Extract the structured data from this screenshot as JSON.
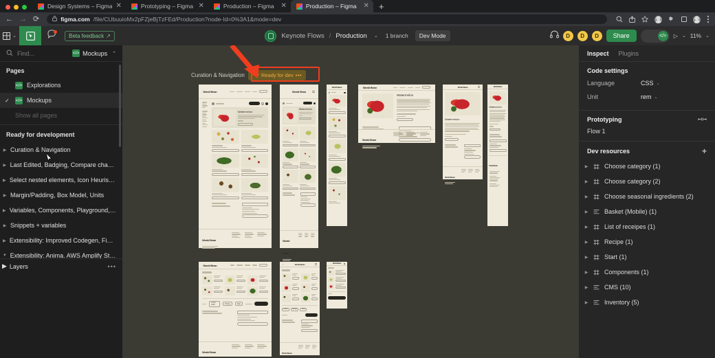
{
  "browser": {
    "tabs": [
      {
        "title": "Design Systems – Figma",
        "active": false
      },
      {
        "title": "Prototyping – Figma",
        "active": false
      },
      {
        "title": "Production – Figma",
        "active": false
      },
      {
        "title": "Production – Figma",
        "active": true
      }
    ],
    "new_tab_label": "+",
    "close_label": "✕",
    "back_label": "←",
    "forward_label": "→",
    "reload_label": "⟳",
    "url_host": "figma.com",
    "url_path": "/file/CUbuuioMx2pFZjeBjTzFEd/Production?node-Id=0%3A1&mode=dev",
    "lock_label": "🔒",
    "toolbar_icons": [
      "search-icon",
      "share-icon",
      "bookmark-star-icon",
      "extension-puzzle-icon",
      "sidepanel-icon",
      "profile-icon",
      "menu-kebab-icon"
    ],
    "profile_initial": ""
  },
  "figma_toolbar": {
    "menu_label": "",
    "caret": "⌄",
    "move_tool": "cursor-tool",
    "comment_tool": "comment-tool",
    "beta_feedback": "Beta feedback",
    "beta_external_icon": "↗",
    "team_name": "Keynote Flows",
    "separator": "/",
    "file_name": "Production",
    "file_caret": "⌄",
    "branch": "1 branch",
    "mode_pill": "Dev Mode",
    "audio_icon": "headphones-icon",
    "avatars": [
      "D",
      "D",
      "D"
    ],
    "share_label": "Share",
    "dev_toggle_icon": "</>",
    "present_label": "▷",
    "present_caret": "⌄",
    "zoom_level": "11%",
    "zoom_caret": "⌄"
  },
  "left_panel": {
    "search_placeholder": "Find...",
    "page_chip": "Mockups",
    "page_chip_caret": "⌃",
    "pages_title": "Pages",
    "pages": [
      {
        "label": "Explorations",
        "selected": false,
        "checked": false
      },
      {
        "label": "Mockups",
        "selected": true,
        "checked": true
      },
      {
        "label": "Show all pages",
        "selected": false,
        "checked": false
      }
    ],
    "sections": [
      {
        "label": "Ready for development",
        "bold": true,
        "expandable": false
      },
      {
        "label": "Curation & Navigation",
        "bold": false,
        "expandable": true
      },
      {
        "label": "Last Edited, Badging, Compare changes",
        "bold": false,
        "expandable": true
      },
      {
        "label": "Select nested elements, Icon Heuristics, As...",
        "bold": false,
        "expandable": true
      },
      {
        "label": "Margin/Padding, Box Model, Units",
        "bold": false,
        "expandable": true
      },
      {
        "label": "Variables, Components, Playground, Dev Re...",
        "bold": false,
        "expandable": true
      },
      {
        "label": "Snippets + variables",
        "bold": false,
        "expandable": true
      },
      {
        "label": "Extensibility: Improved Codegen, Figma To ...",
        "bold": false,
        "expandable": true
      },
      {
        "label": "Extensibility: Anima. AWS Amplify Studio",
        "bold": false,
        "expandable": true
      }
    ],
    "layers_label": "Layers",
    "layers_more": "•••"
  },
  "right_panel": {
    "tabs": [
      {
        "label": "Inspect",
        "active": true
      },
      {
        "label": "Plugins",
        "active": false
      }
    ],
    "code_settings": {
      "title": "Code settings",
      "rows": [
        {
          "label": "Language",
          "value": "CSS",
          "caret": "⌄"
        },
        {
          "label": "Unit",
          "value": "rem",
          "caret": "⌄"
        }
      ]
    },
    "prototyping": {
      "title": "Prototyping",
      "icon": "flow-connector-icon",
      "flow": "Flow 1"
    },
    "dev_resources": {
      "title": "Dev resources",
      "add_label": "+",
      "items": [
        {
          "label": "Choose category (1)",
          "icon": "frame-icon"
        },
        {
          "label": "Choose category (2)",
          "icon": "frame-icon"
        },
        {
          "label": "Choose seasonal ingredients (2)",
          "icon": "frame-icon"
        },
        {
          "label": "Basket (Mobile) (1)",
          "icon": "section-icon"
        },
        {
          "label": "List of receipes (1)",
          "icon": "frame-icon"
        },
        {
          "label": "Recipe (1)",
          "icon": "frame-icon"
        },
        {
          "label": "Start (1)",
          "icon": "frame-icon"
        },
        {
          "label": "Components (1)",
          "icon": "frame-icon"
        },
        {
          "label": "CMS (10)",
          "icon": "section-icon"
        },
        {
          "label": "Inventory (5)",
          "icon": "section-icon"
        }
      ]
    }
  },
  "canvas": {
    "section_title": "Curation & Navigation",
    "status_badge": {
      "label": "Ready for dev",
      "code_icon": "</>",
      "ellipsis": "•••",
      "bg_color": "#6b5a23",
      "text_color": "#f0a945"
    },
    "annotation": {
      "color": "#f03d1e",
      "shape": "arrow-and-rectangle"
    },
    "mockup_brand": "World Bean",
    "mockup_headline": "Watermelon"
  },
  "colors": {
    "figma_green": "#2e8b4e",
    "canvas_bg": "#3b3b34",
    "panel_bg": "#1e1e1e",
    "right_panel_bg": "#262626",
    "mockup_paper": "#efeadb",
    "annotation_red": "#f03d1e",
    "ready_for_dev": "#f0a945"
  }
}
